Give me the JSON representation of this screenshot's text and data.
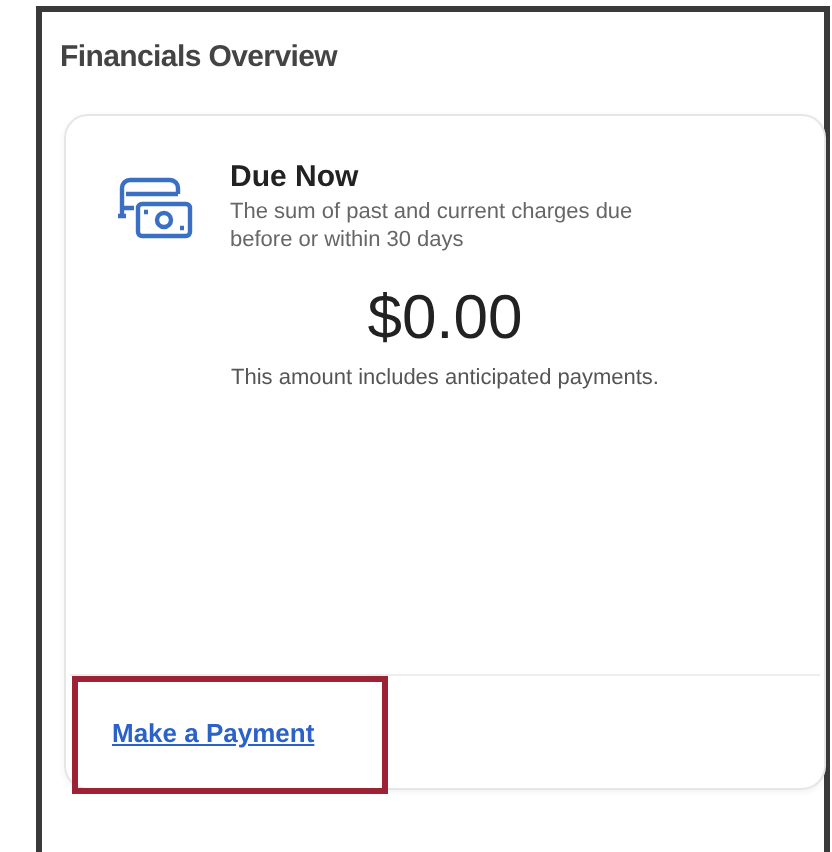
{
  "section_title": "Financials Overview",
  "card": {
    "title": "Due Now",
    "description": "The sum of past and current charges due before or within 30 days",
    "amount": "$0.00",
    "note": "This amount includes anticipated payments."
  },
  "action_link": "Make a Payment"
}
